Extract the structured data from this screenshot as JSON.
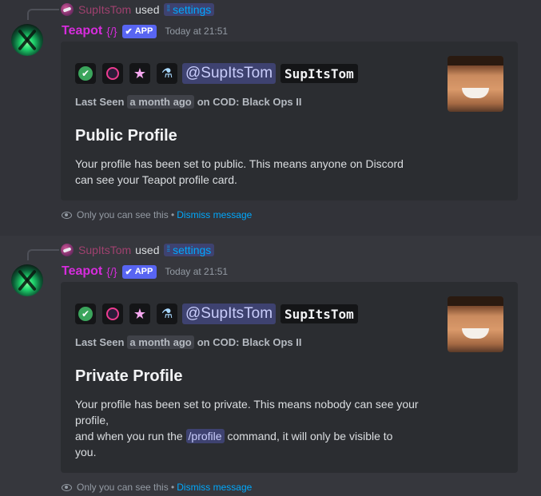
{
  "messages": [
    {
      "reference": {
        "username": "SupItsTom",
        "used_text": "used",
        "command": "settings",
        "command_icon": "slash-command-icon"
      },
      "author": {
        "name": "Teapot",
        "name_glyph": "{/}",
        "tag": "APP",
        "timestamp": "Today at 21:51"
      },
      "embed": {
        "mention": "@SupItsTom",
        "username": "SupItsTom",
        "last_seen_label": "Last Seen",
        "last_seen_time": "a month ago",
        "last_seen_game": "on COD: Black Ops II",
        "title": "Public Profile",
        "description_lines": [
          "Your profile has been set to public. This means anyone on Discord",
          "can see your Teapot profile card."
        ]
      },
      "ephemeral": {
        "text": "Only you can see this •",
        "dismiss": "Dismiss message"
      }
    },
    {
      "reference": {
        "username": "SupItsTom",
        "used_text": "used",
        "command": "settings",
        "command_icon": "slash-command-icon"
      },
      "author": {
        "name": "Teapot",
        "name_glyph": "{/}",
        "tag": "APP",
        "timestamp": "Today at 21:51"
      },
      "embed": {
        "mention": "@SupItsTom",
        "username": "SupItsTom",
        "last_seen_label": "Last Seen",
        "last_seen_time": "a month ago",
        "last_seen_game": "on COD: Black Ops II",
        "title": "Private Profile",
        "description_line1": "Your profile has been set to private. This means nobody can see your",
        "description_line2": "profile,",
        "description_line3_pre": "and when you run the",
        "description_code": "/profile",
        "description_line3_post": "command, it will only be visible to",
        "description_line4": "you."
      },
      "ephemeral": {
        "text": "Only you can see this •",
        "dismiss": "Dismiss message"
      }
    }
  ],
  "colors": {
    "bot_name": "#d62cdc",
    "app_tag": "#5865f2",
    "link": "#00a8fc",
    "embed_bg": "#2b2d31"
  }
}
